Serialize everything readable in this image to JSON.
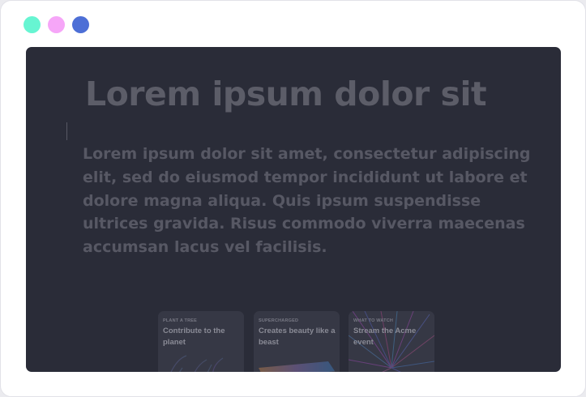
{
  "colors": {
    "page_bg": "#ebebef",
    "window_bg": "#ffffff",
    "screen_bg": "#2a2c38",
    "headline": "#5c5d68",
    "body_text": "#575864",
    "card_bg": "#363845",
    "card_eyebrow": "#777884",
    "card_title": "#8a8b96",
    "dot_teal": "#67f5d2",
    "dot_pink": "#f6a6f8",
    "dot_blue": "#4d6fd6"
  },
  "window": {
    "dots": [
      {
        "name": "teal-dot",
        "color": "#67f5d2"
      },
      {
        "name": "pink-dot",
        "color": "#f6a6f8"
      },
      {
        "name": "blue-dot",
        "color": "#4d6fd6"
      }
    ]
  },
  "hero": {
    "headline": "Lorem ipsum dolor sit",
    "body": "Lorem ipsum dolor sit amet, consectetur adipiscing elit, sed do eiusmod tempor incididunt ut labore et dolore magna aliqua. Quis ipsum suspendisse ultrices gravida. Risus commodo viverra maecenas accumsan lacus vel facilisis."
  },
  "cards": [
    {
      "eyebrow": "PLANT A TREE",
      "title": "Contribute to the planet",
      "icon": "plant-art"
    },
    {
      "eyebrow": "SUPERCHARGED",
      "title": "Creates beauty like a beast",
      "icon": "laptop-art"
    },
    {
      "eyebrow": "WHAT TO WATCH",
      "title": "Stream the Acme event",
      "icon": "firework-art"
    }
  ]
}
